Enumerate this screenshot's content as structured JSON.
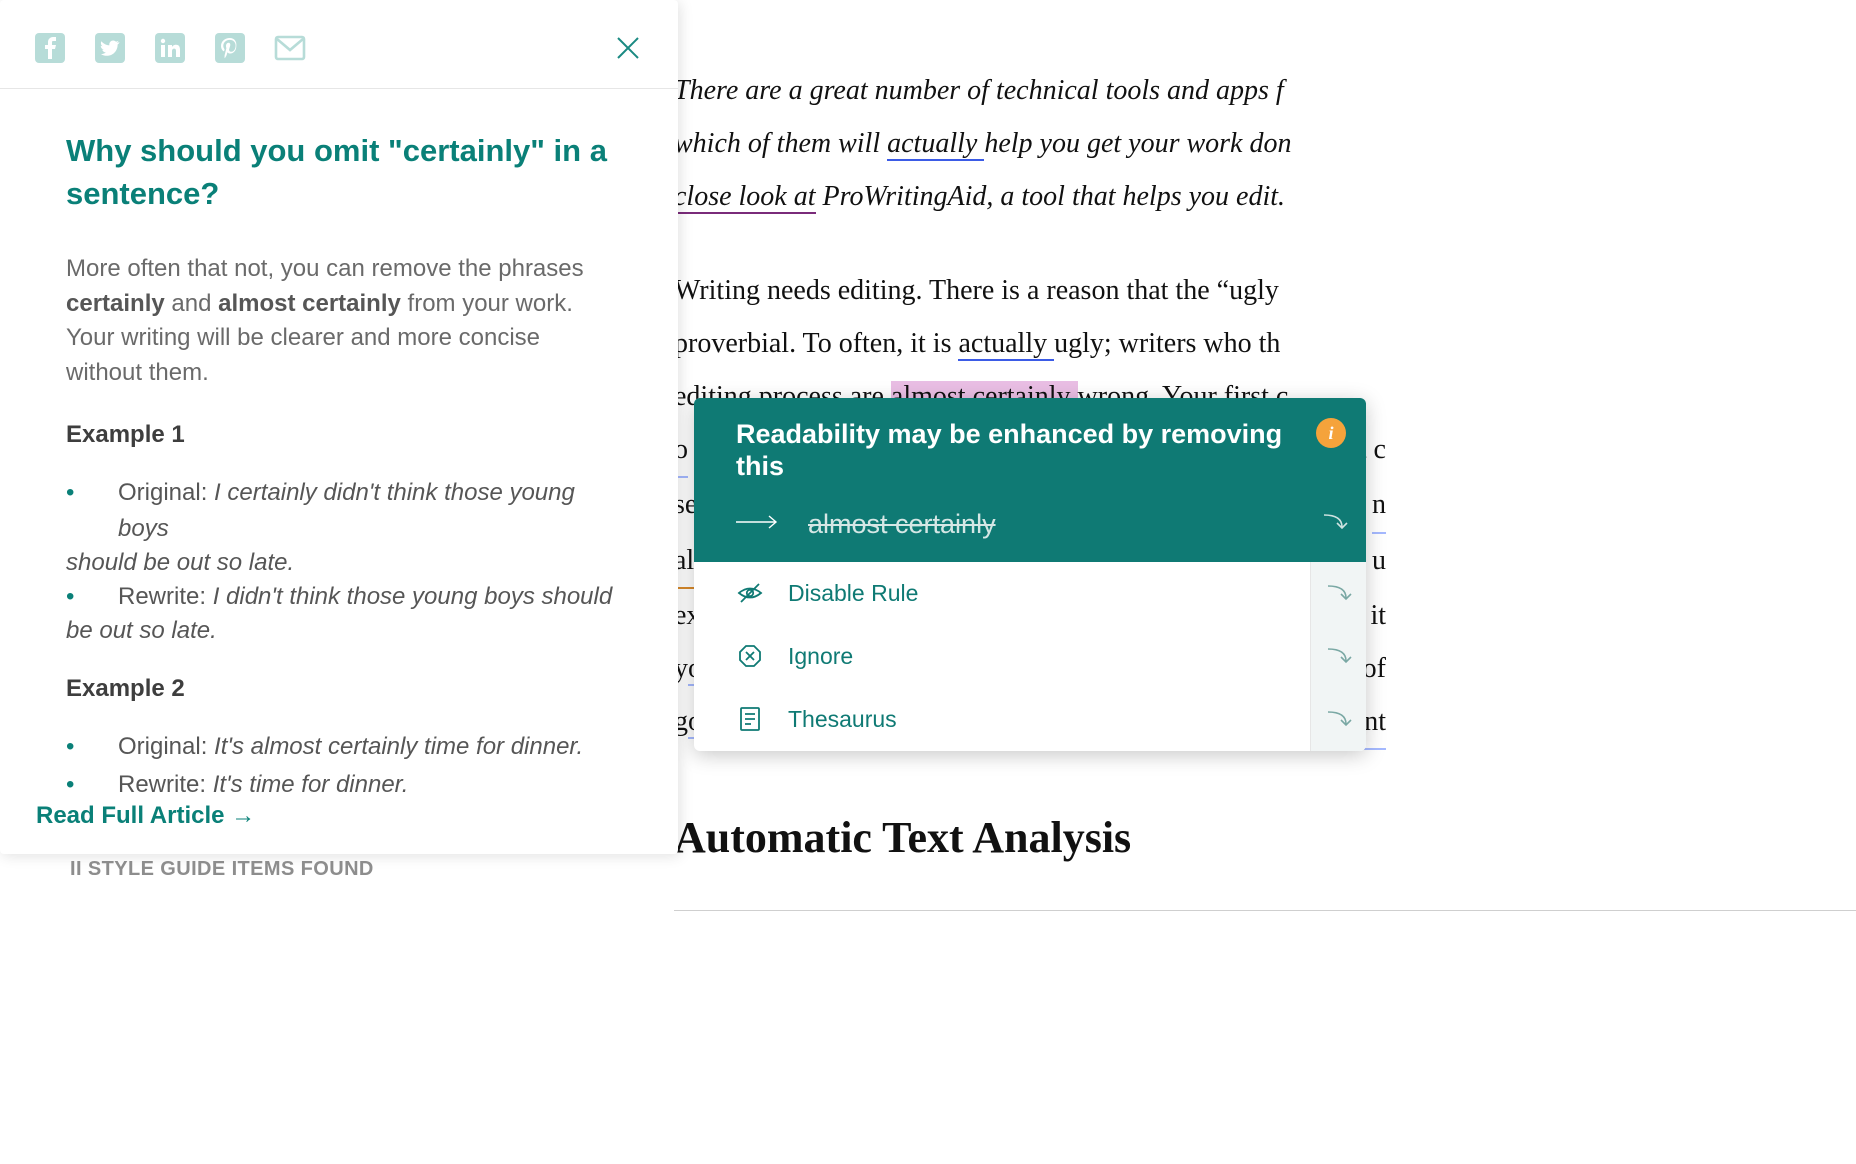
{
  "panel": {
    "title": "Why should you omit \"certainly\" in a sentence?",
    "intro_prefix": "More often that not, you can remove the phrases ",
    "intro_bold1": "certainly",
    "intro_mid": " and ",
    "intro_bold2": "almost certainly",
    "intro_suffix": " from your work. Your writing will be clearer and more concise without them.",
    "example1_heading": "Example 1",
    "ex1_original_label": "Original: ",
    "ex1_original_text_a": "I certainly didn't think those young boys",
    "ex1_original_text_b": "should be out so late.",
    "ex1_rewrite_label": "Rewrite: ",
    "ex1_rewrite_text_a": "I didn't think those young boys should",
    "ex1_rewrite_text_b": "be out so late.",
    "example2_heading": "Example 2",
    "ex2_original_label": "Original: ",
    "ex2_original_text": "It's almost certainly time for dinner.",
    "ex2_rewrite_label": "Rewrite: ",
    "ex2_rewrite_text": "It's time for dinner.",
    "read_full": "Read Full Article →",
    "peek": "II STYLE GUIDE ITEMS FOUND"
  },
  "doc": {
    "l1_a": "There are a great number of technical tools and apps f",
    "l2_a": "which of them will ",
    "l2_u": "actually ",
    "l2_b": "help you get your work do",
    "l2_c": "n",
    "l3_a": "close look at",
    "l3_b": " ProWritingAid, a tool that helps you edit.",
    "l4_a": "Writing needs editing. There is a reason that the “ugly",
    "l5_a": "proverbial. To often, it is ",
    "l5_u": "actually ",
    "l5_b": "ugly; writers who th",
    "l6_a": "editing process are ",
    "l6_hl": "almost certainly ",
    "l6_b": "wrong. ",
    "l6_u": "Your first c",
    "l7_a": "o",
    "l7_b": "t c",
    "l8_a": "se",
    "l8_b": "n",
    "l9_a": "al",
    "l9_b": "e u",
    "l10_a": "ex",
    "l10_b": "it",
    "l11_a": "y",
    "l11_b": "o",
    "l11_c": "of",
    "l12_a": "g",
    "l12_b": "o",
    "l12_c": "nt",
    "heading": "Automatic Text Analysis"
  },
  "popover": {
    "title": "Readability may be enhanced by removing this",
    "suggestion": "almost certainly",
    "disable": "Disable Rule",
    "ignore": "Ignore",
    "thesaurus": "Thesaurus",
    "info": "i"
  }
}
